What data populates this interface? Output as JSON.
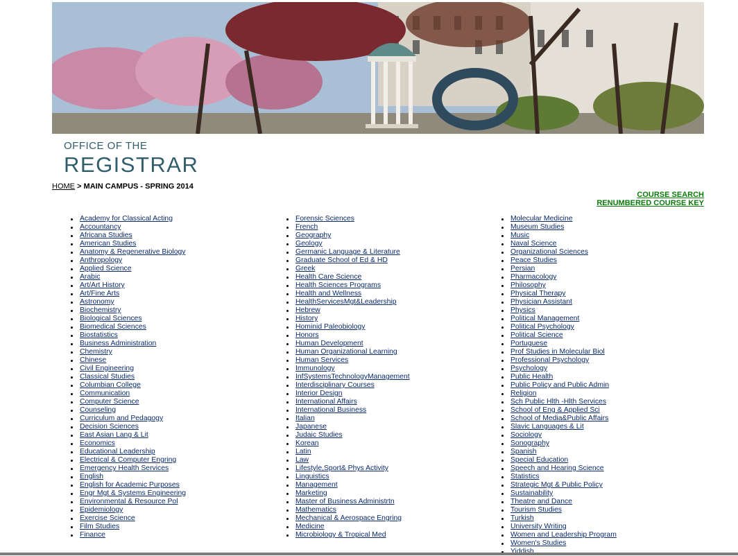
{
  "header": {
    "logo_line1": "OFFICE OF THE",
    "logo_line2": "REGISTRAR"
  },
  "breadcrumb": {
    "home": "HOME",
    "separator": " > ",
    "current": "MAIN CAMPUS - SPRING 2014"
  },
  "top_links": {
    "course_search": "COURSE SEARCH",
    "renumbered_key": "RENUMBERED COURSE KEY"
  },
  "colors": {
    "link": "#0a2a6b",
    "top_link": "#0c7a0c",
    "logo": "#2f5d6b"
  },
  "columns": [
    [
      "Academy for Classical Acting",
      "Accountancy",
      "Africana Studies",
      "American Studies",
      "Anatomy & Regenerative Biology",
      "Anthropology",
      "Applied Science",
      "Arabic",
      "Art/Art History",
      "Art/Fine Arts",
      "Astronomy",
      "Biochemistry",
      "Biological Sciences",
      "Biomedical Sciences",
      "Biostatistics",
      "Business Administration",
      "Chemistry",
      "Chinese",
      "Civil Engineering",
      "Classical Studies",
      "Columbian College",
      "Communication",
      "Computer Science",
      "Counseling",
      "Curriculum and Pedagogy",
      "Decision Sciences",
      "East Asian Lang & Lit",
      "Economics",
      "Educational Leadership",
      "Electrical & Computer Engring",
      "Emergency Health Services",
      "English",
      "English for Academic Purposes",
      "Engr Mgt & Systems Engineering",
      "Environmental & Resource Pol",
      "Epidemiology",
      "Exercise Science",
      "Film Studies",
      "Finance"
    ],
    [
      "Forensic Sciences",
      "French",
      "Geography",
      "Geology",
      "Germanic Language & Literature",
      "Graduate School of Ed & HD",
      "Greek",
      "Health Care Science",
      "Health Sciences Programs",
      "Health and Wellness",
      "HealthServicesMgt&Leadership",
      "Hebrew",
      "History",
      "Hominid Paleobiology",
      "Honors",
      "Human Development",
      "Human Organizational Learning",
      "Human Services",
      "Immunology",
      "InfSystemsTechnologyManagement",
      "Interdisciplinary Courses",
      "Interior Design",
      "International Affairs",
      "International Business",
      "Italian",
      "Japanese",
      "Judaic Studies",
      "Korean",
      "Latin",
      "Law",
      "Lifestyle,Sport& Phys Activity",
      "Linguistics",
      "Management",
      "Marketing",
      "Master of Business Administrtn",
      "Mathematics",
      "Mechanical & Aerospace Engring",
      "Medicine",
      "Microbiology & Tropical Med"
    ],
    [
      "Molecular Medicine",
      "Museum Studies",
      "Music",
      "Naval Science",
      "Organizational Sciences",
      "Peace Studies",
      "Persian",
      "Pharmacology",
      "Philosophy",
      "Physical Therapy",
      "Physician Assistant",
      "Physics",
      "Political Management",
      "Political Psychology",
      "Political Science",
      "Portuguese",
      "Prof Studies in Molecular Biol",
      "Professional Psychology",
      "Psychology",
      "Public Health",
      "Public Policy and Public Admin",
      "Religion",
      "Sch Public Hlth -Hlth Services",
      "School of Eng & Applied Sci",
      "School of Media&Public Affairs",
      "Slavic Languages & Lit",
      "Sociology",
      "Sonography",
      "Spanish",
      "Special Education",
      "Speech and Hearing Science",
      "Statistics",
      "Strategic Mgt & Public Policy",
      "Sustainability",
      "Theatre and Dance",
      "Tourism Studies",
      "Turkish",
      "University Writing",
      "Women and Leadership Program",
      "Women's Studies",
      "Yiddish"
    ]
  ]
}
